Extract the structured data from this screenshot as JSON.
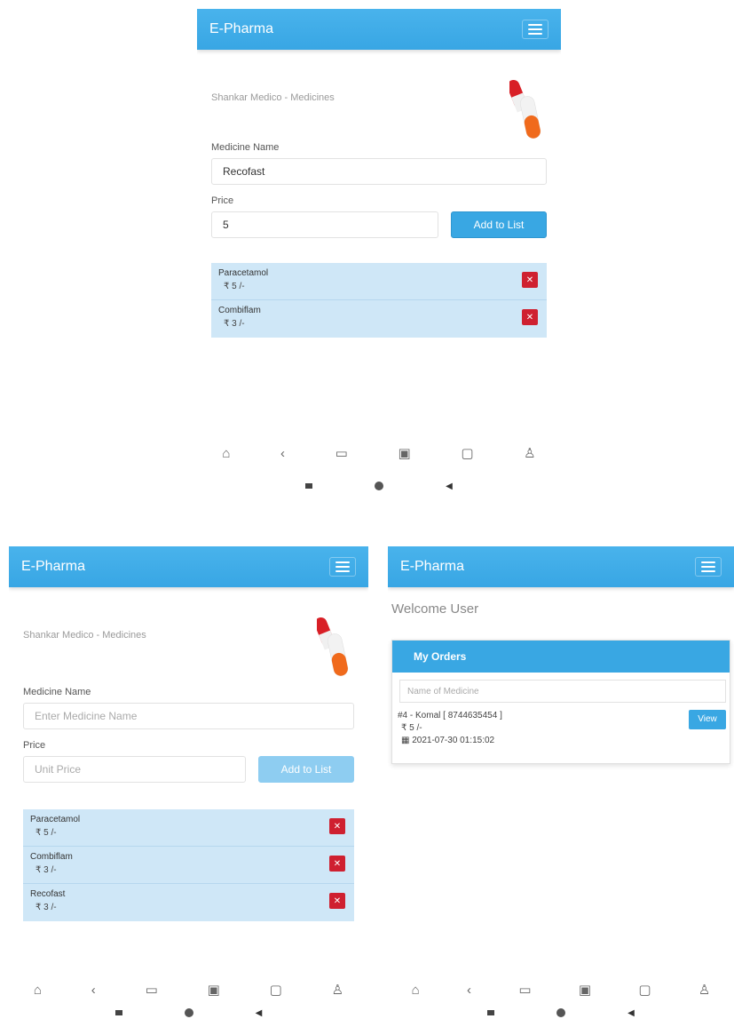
{
  "brand": "E-Pharma",
  "shop_name": "Shankar Medico - Medicines",
  "form": {
    "medicine_label": "Medicine Name",
    "price_label": "Price",
    "add_button": "Add to List",
    "medicine_placeholder": "Enter Medicine Name",
    "price_placeholder": "Unit Price"
  },
  "screen1": {
    "medicine_value": "Recofast",
    "price_value": "5",
    "items": [
      {
        "name": "Paracetamol",
        "price": "₹ 5 /-"
      },
      {
        "name": "Combiflam",
        "price": "₹ 3 /-"
      }
    ]
  },
  "screen2": {
    "items": [
      {
        "name": "Paracetamol",
        "price": "₹ 5 /-"
      },
      {
        "name": "Combiflam",
        "price": "₹ 3 /-"
      },
      {
        "name": "Recofast",
        "price": "₹ 3 /-"
      }
    ]
  },
  "screen3": {
    "welcome": "Welcome User",
    "card_title": "My Orders",
    "search_placeholder": "Name of Medicine",
    "order": {
      "title": "#4 - Komal [ 8744635454 ]",
      "price": "₹ 5 /-",
      "date": "2021-07-30 01:15:02",
      "view_button": "View"
    }
  },
  "nav_icons": [
    "home-icon",
    "back-icon",
    "book-icon",
    "tab-icon",
    "folder-icon",
    "profile-icon"
  ],
  "colors": {
    "primary": "#39a7e3",
    "danger": "#cf2030",
    "list_bg": "#cfe7f7"
  }
}
